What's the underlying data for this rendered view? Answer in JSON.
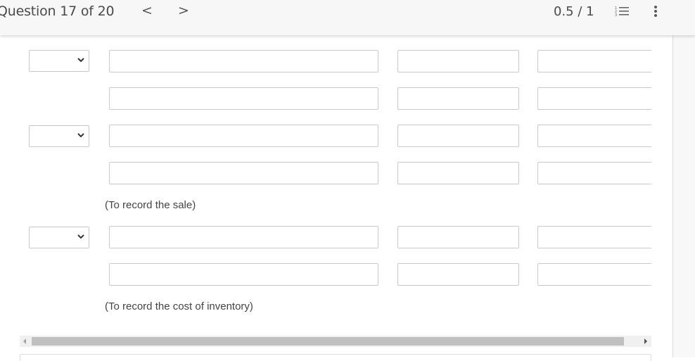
{
  "header": {
    "question_label": "Question 17 of 20",
    "prev_icon": "chevron-left-icon",
    "next_icon": "chevron-right-icon",
    "prev_glyph": "<",
    "next_glyph": ">",
    "score": "0.5 / 1",
    "list_icon": "numbered-list-icon",
    "more_icon": "more-vertical-icon"
  },
  "journal": {
    "rows": [
      {
        "has_select": true,
        "select_value": "",
        "account": "",
        "debit": "",
        "credit": ""
      },
      {
        "has_select": false,
        "account": "",
        "debit": "",
        "credit": ""
      },
      {
        "has_select": true,
        "select_value": "",
        "account": "",
        "debit": "",
        "credit": ""
      },
      {
        "has_select": false,
        "account": "",
        "debit": "",
        "credit": ""
      },
      {
        "has_select": true,
        "select_value": "",
        "account": "",
        "debit": "",
        "credit": ""
      },
      {
        "has_select": false,
        "account": "",
        "debit": "",
        "credit": ""
      }
    ],
    "notes": [
      "(To record the sale)",
      "(To record the cost of inventory)"
    ]
  },
  "colors": {
    "header_bg": "#f7f7f7",
    "input_border": "#cacaca",
    "scroll_thumb": "#c0c0c0",
    "text": "#4a4a4a"
  }
}
